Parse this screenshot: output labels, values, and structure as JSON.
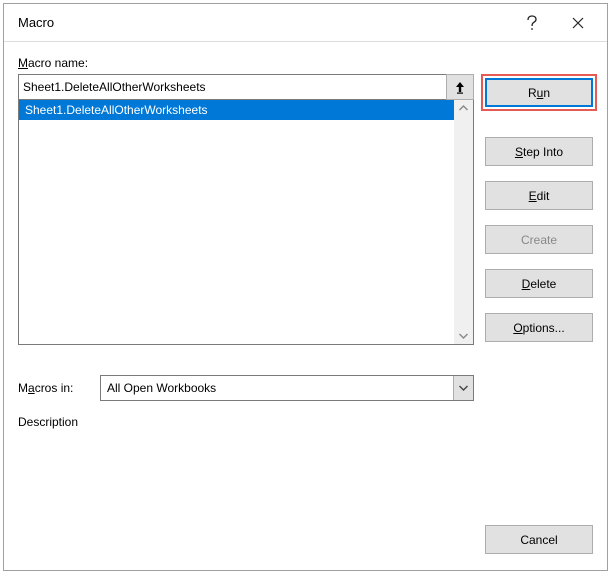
{
  "titlebar": {
    "title": "Macro"
  },
  "labels": {
    "macro_name_pre": "M",
    "macro_name_rest": "acro name:",
    "macros_in_pre": "M",
    "macros_in_rest": "acros in:",
    "description": "Description"
  },
  "fields": {
    "macro_name": "Sheet1.DeleteAllOtherWorksheets",
    "macros_in": "All Open Workbooks"
  },
  "list": {
    "items": [
      {
        "label": "Sheet1.DeleteAllOtherWorksheets",
        "selected": true
      }
    ]
  },
  "buttons": {
    "run_pre": "R",
    "run_mid": "u",
    "run_post": "n",
    "step_pre": "S",
    "step_mid": "tep Into",
    "edit_pre": "E",
    "edit_post": "dit",
    "create": "Create",
    "delete_pre": "D",
    "delete_post": "elete",
    "options_pre": "O",
    "options_post": "ptions...",
    "cancel": "Cancel"
  }
}
